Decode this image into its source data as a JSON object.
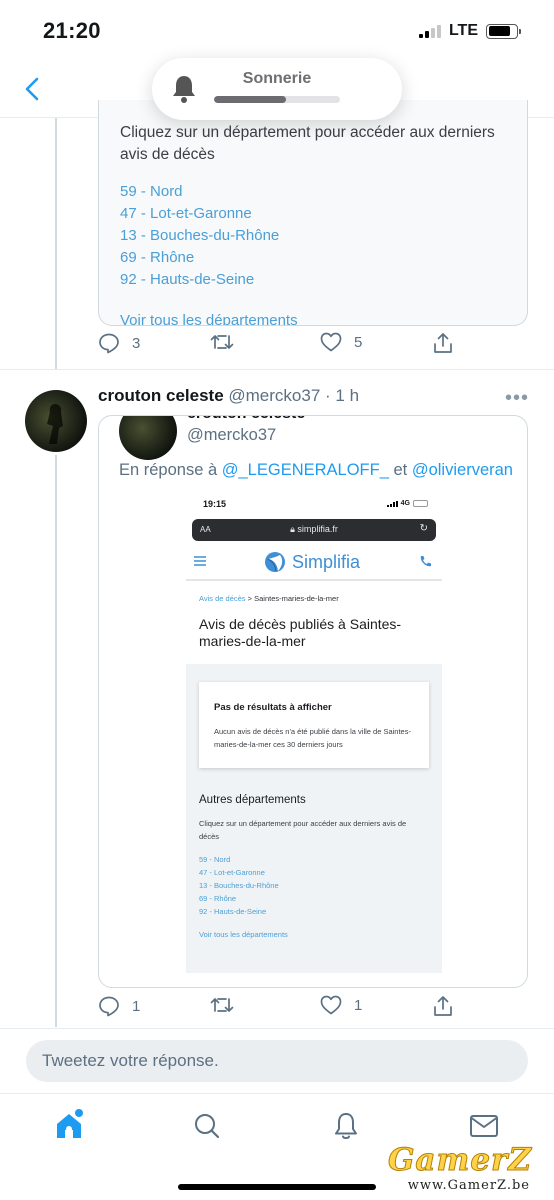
{
  "status_bar": {
    "time": "21:20",
    "network": "LTE",
    "signal_bars_active": 2,
    "signal_bars_total": 4,
    "battery_level": 0.8
  },
  "nav": {
    "back_icon": "chevron-left-icon"
  },
  "ringer": {
    "label": "Sonnerie",
    "icon": "bell-icon",
    "volume_level": 0.57
  },
  "tweet1": {
    "card": {
      "intro": "Cliquez sur un département pour accéder aux derniers avis de décès",
      "departments": [
        "59 - Nord",
        "47 - Lot-et-Garonne",
        "13 - Bouches-du-Rhône",
        "69 - Rhône",
        "92 - Hauts-de-Seine"
      ],
      "see_all": "Voir tous les départements"
    },
    "actions": {
      "replies": "3",
      "retweets": "",
      "likes": "5"
    }
  },
  "tweet2": {
    "author_name": "crouton celeste",
    "author_meta": "@mercko37 · 1 h",
    "quote": {
      "author_name": "crouton celeste",
      "author_handle": "@mercko37",
      "reply_prefix": "En réponse à",
      "mention1": "@_LEGENERALOFF_",
      "reply_joiner": "et",
      "mention2": "@olivierveran",
      "screenshot": {
        "time": "19:15",
        "network": "4G",
        "aa": "AA",
        "domain": "simplifia.fr",
        "brand": "Simplifia",
        "breadcrumb_link": "Avis de décès",
        "breadcrumb_rest": " > Saintes-maries-de-la-mer",
        "title": "Avis de décès publiés à Saintes-maries-de-la-mer",
        "no_result_title": "Pas de résultats à afficher",
        "no_result_text": "Aucun avis de décès n'a été publié dans la ville de Saintes-maries-de-la-mer ces 30 derniers jours",
        "other_title": "Autres départements",
        "other_intro": "Cliquez sur un département pour accéder aux derniers avis de décès",
        "departments": [
          "59 - Nord",
          "47 - Lot-et-Garonne",
          "13 - Bouches-du-Rhône",
          "69 - Rhône",
          "92 - Hauts-de-Seine"
        ],
        "see_all": "Voir tous les départements"
      }
    },
    "actions": {
      "replies": "1",
      "retweets": "",
      "likes": "1"
    }
  },
  "reply_bar": {
    "placeholder": "Tweetez votre réponse."
  },
  "tab_bar": {
    "items": [
      "home-icon",
      "search-icon",
      "notifications-icon",
      "messages-icon"
    ]
  },
  "watermark": {
    "logo": "GamerZ",
    "url": "www.GamerZ.be"
  },
  "colors": {
    "accent": "#1d9bf0",
    "link": "#4a9fd6",
    "muted": "#5b7083",
    "border": "#cfd9de"
  }
}
